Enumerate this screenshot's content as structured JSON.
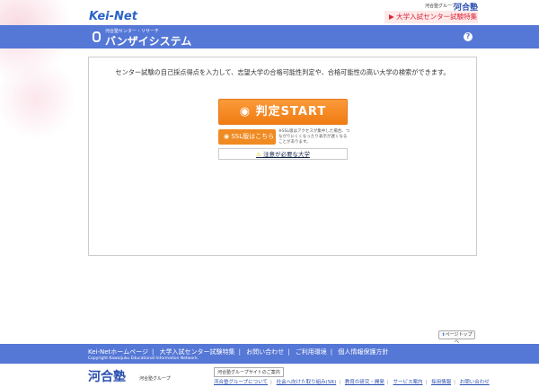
{
  "header": {
    "group_label": "河合塾グループ",
    "kawaijuku_logo": "河合塾",
    "keinet_logo": "Kei-Net",
    "center_special_link": "▶ 大学入試センター試験特集"
  },
  "system": {
    "subtitle": "河合塾センター・リサーチ",
    "title": "バンザイシステム",
    "help": "?"
  },
  "main": {
    "intro": "センター試験の自己採点得点を入力して、志望大学の合格可能性判定や、合格可能性の高い大学の検索ができます。",
    "start_button": "判定START",
    "ssl_button": "SSL版はこちら",
    "ssl_note": "※SSL版はアクセスが集中した場合、つながりにくくなったり表示が遅くなることがあります。",
    "caution_link": "注意が必要な大学"
  },
  "page_top": "ページトップへ",
  "footer": {
    "links": [
      "Kei-Netホームページ",
      "大学入試センター試験特集",
      "お問い合わせ",
      "ご利用環境",
      "個人情報保護方針"
    ],
    "copyright": "Copyright Kawaijuku Educational Information Network."
  },
  "bottom": {
    "logo": "河合塾",
    "group": "河合塾グループ",
    "group_site": "河合塾グループサイトのご案内",
    "links": [
      "河合塾グループについて",
      "社会へ向けた取り組み(SR)",
      "教育の研究・開発",
      "サービス案内",
      "採用情報",
      "お問い合わせ"
    ]
  }
}
